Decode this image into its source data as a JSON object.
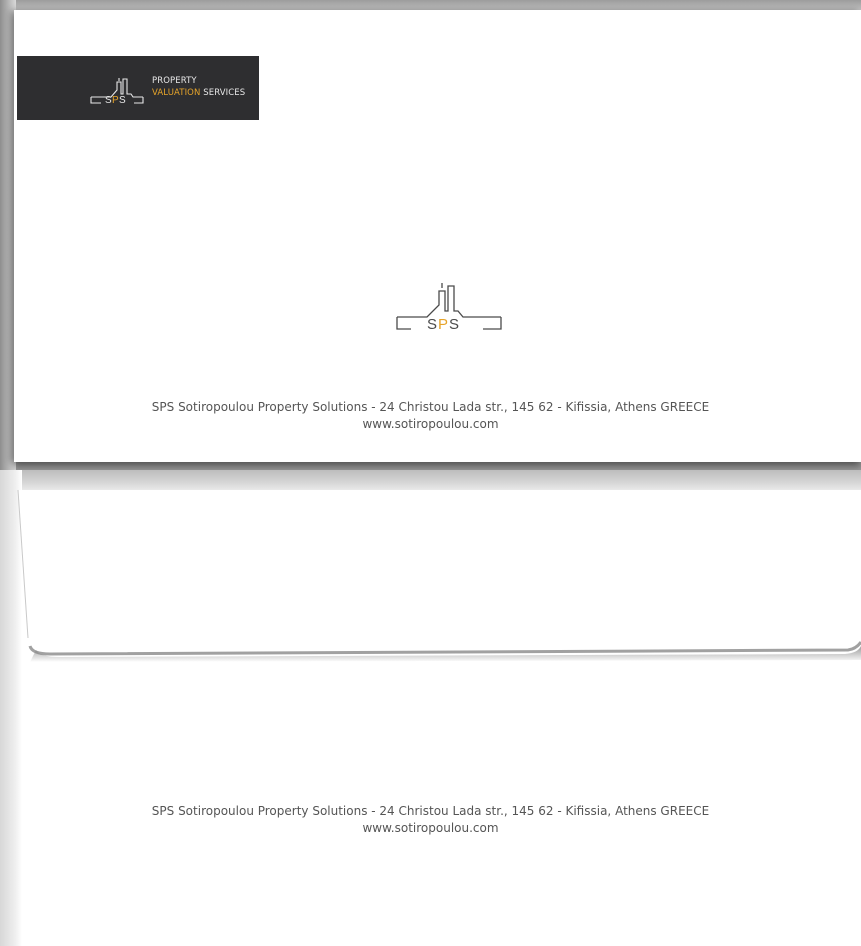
{
  "envelope_front": {
    "logo": {
      "brand": "SPS",
      "line1": "PROPERTY",
      "line2_gold": "VALUATION",
      "line2_rest": " SERVICES"
    },
    "footer": {
      "address": "SPS Sotiropoulou Property Solutions - 24 Christou Lada str., 145 62 - Kifissia, Athens GREECE",
      "website": "www.sotiropoulou.com"
    }
  },
  "envelope_back": {
    "logo": {
      "brand": "SPS"
    },
    "footer": {
      "address": "SPS Sotiropoulou Property Solutions - 24 Christou Lada str., 145 62 - Kifissia, Athens GREECE",
      "website": "www.sotiropoulou.com"
    }
  },
  "colors": {
    "logo_background": "#2e2e30",
    "accent_gold": "#e6a42a",
    "footer_text": "#555555"
  }
}
